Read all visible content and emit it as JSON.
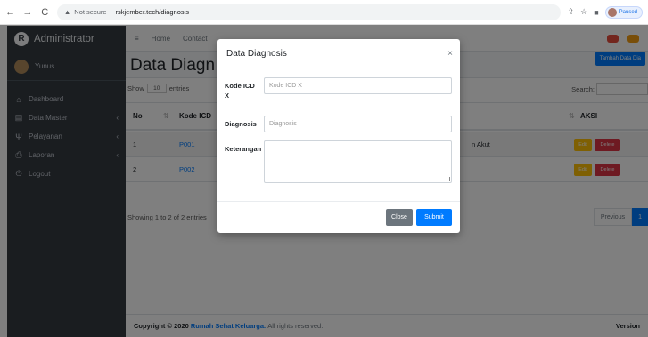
{
  "browser": {
    "not_secure": "Not secure",
    "url": "rskjember.tech/diagnosis",
    "profile_label": "Paused"
  },
  "sidebar": {
    "brand": "Administrator",
    "user": "Yunus",
    "items": [
      {
        "label": "Dashboard",
        "icon": "home-icon"
      },
      {
        "label": "Data Master",
        "icon": "database-icon"
      },
      {
        "label": "Pelayanan",
        "icon": "stethoscope-icon"
      },
      {
        "label": "Laporan",
        "icon": "print-icon"
      },
      {
        "label": "Logout",
        "icon": "power-icon"
      }
    ]
  },
  "header": {
    "menu_icon": "≡",
    "home": "Home",
    "contact": "Contact"
  },
  "content": {
    "title": "Data Diagn",
    "add_button": "Tambah Data Dia",
    "show_prefix": "Show",
    "show_value": "10",
    "show_suffix": "entries",
    "search_label": "Search:",
    "columns": {
      "no": "No",
      "kode": "Kode ICD",
      "aksi": "AKSI"
    },
    "rows": [
      {
        "no": "1",
        "kode": "P001",
        "keterangan": "n Akut",
        "edit": "Edit",
        "delete": "Delete"
      },
      {
        "no": "2",
        "kode": "P002",
        "keterangan": "",
        "edit": "Edit",
        "delete": "Delete"
      }
    ],
    "info": "Showing 1 to 2 of 2 entries",
    "pager_prev": "Previous",
    "pager_page": "1"
  },
  "footer": {
    "prefix": "Copyright © 2020",
    "brand": "Rumah Sehat Keluarga.",
    "suffix": "All rights reserved.",
    "version": "Version"
  },
  "modal": {
    "title": "Data Diagnosis",
    "close_icon": "×",
    "fields": {
      "kode_label": "Kode ICD X",
      "kode_placeholder": "Kode ICD X",
      "diagnosis_label": "Diagnosis",
      "diagnosis_placeholder": "Diagnosis",
      "keterangan_label": "Keterangan"
    },
    "close_button": "Close",
    "submit_button": "Submit"
  },
  "colors": {
    "primary": "#007bff",
    "sidebar": "#343a40",
    "edit": "#ffc107",
    "delete": "#dc3545",
    "close": "#6c757d"
  }
}
